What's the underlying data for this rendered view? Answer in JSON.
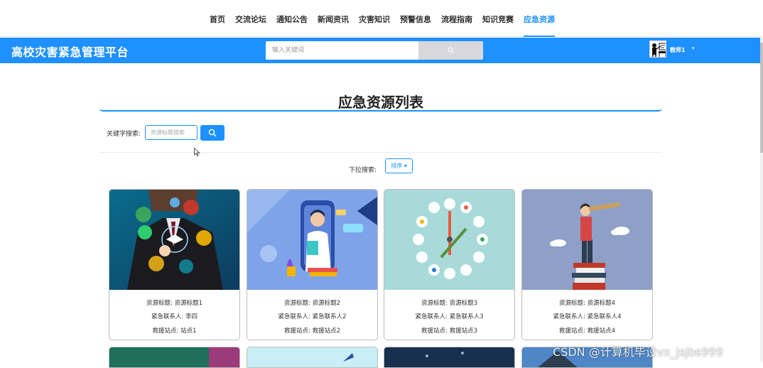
{
  "nav": {
    "items": [
      "首页",
      "交流论坛",
      "通知公告",
      "新闻资讯",
      "灾害知识",
      "预警信息",
      "流程指南",
      "知识竞赛",
      "应急资源"
    ],
    "active": "应急资源"
  },
  "header": {
    "brand": "高校灾害紧急管理平台",
    "search_placeholder": "输入关键词",
    "username": "教师1",
    "caret": "▾"
  },
  "page": {
    "title": "应急资源列表",
    "keyword_label": "关键字搜索:",
    "keyword_placeholder": "资源标题搜索",
    "dropdown_label": "下拉搜索:",
    "sort_label": "排序 ▾"
  },
  "cards": [
    {
      "title_label": "资源标题:",
      "title": "资源标题1",
      "contact_label": "紧急联系人:",
      "contact": "李四",
      "station_label": "救援站点:",
      "station": "站点1"
    },
    {
      "title_label": "资源标题:",
      "title": "资源标题2",
      "contact_label": "紧急联系人:",
      "contact": "紧急联系人2",
      "station_label": "救援站点:",
      "station": "救援站点2"
    },
    {
      "title_label": "资源标题:",
      "title": "资源标题3",
      "contact_label": "紧急联系人:",
      "contact": "紧急联系人3",
      "station_label": "救援站点:",
      "station": "救援站点3"
    },
    {
      "title_label": "资源标题:",
      "title": "资源标题4",
      "contact_label": "紧急联系人:",
      "contact": "紧急联系人4",
      "station_label": "救援站点:",
      "station": "救援站点4"
    }
  ],
  "colors": {
    "accent": "#1e90ff"
  },
  "watermark": "CSDN @计算机毕设vx_jsjbs999"
}
